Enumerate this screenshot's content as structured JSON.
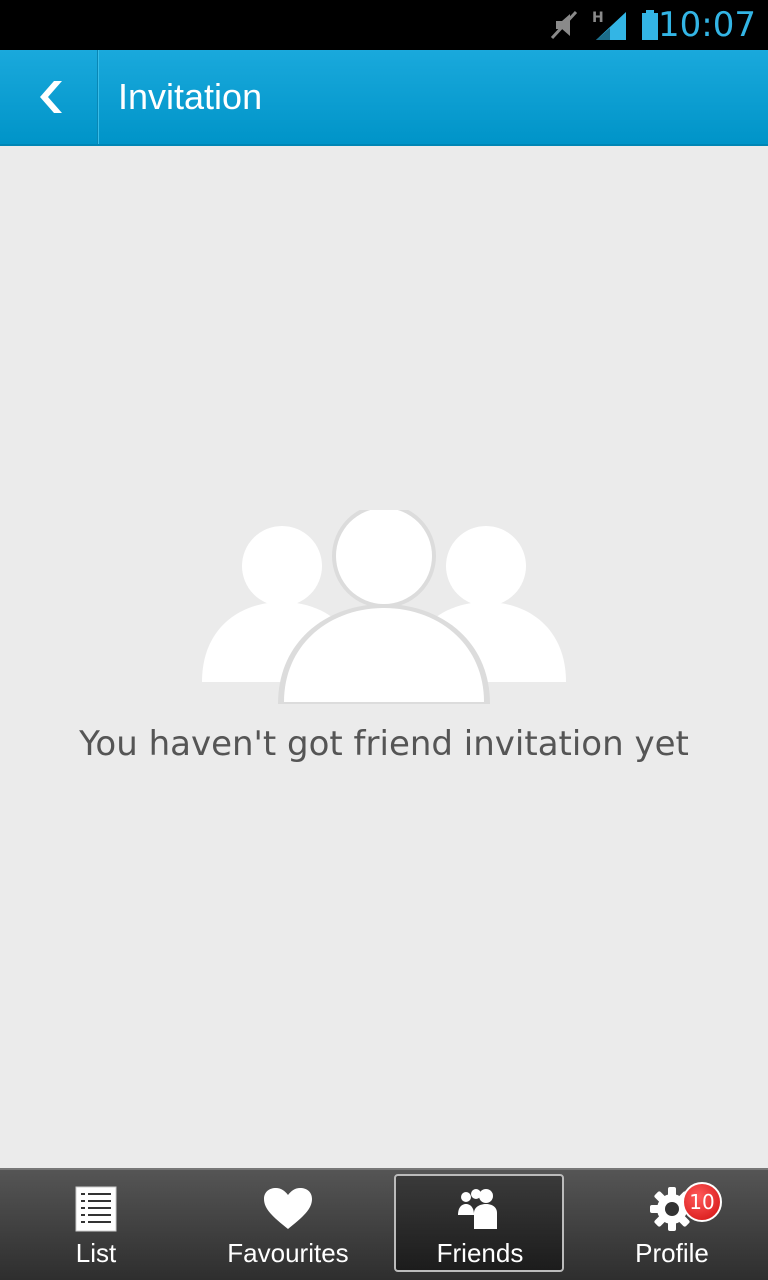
{
  "status_bar": {
    "time": "10:07",
    "network_type": "H",
    "time_color": "#33b5e5",
    "icons": [
      "mute-icon",
      "signal-icon",
      "battery-icon"
    ]
  },
  "header": {
    "title": "Invitation",
    "back_icon": "chevron-left-icon",
    "background_color": "#0094c8"
  },
  "empty_state": {
    "icon": "people-group-icon",
    "message": "You haven't got friend invitation yet"
  },
  "tab_bar": {
    "selected": "Friends",
    "tabs": [
      {
        "label": "List",
        "icon": "list-icon"
      },
      {
        "label": "Favourites",
        "icon": "heart-icon"
      },
      {
        "label": "Friends",
        "icon": "friends-icon"
      },
      {
        "label": "Profile",
        "icon": "gear-icon",
        "badge": "10"
      }
    ]
  }
}
